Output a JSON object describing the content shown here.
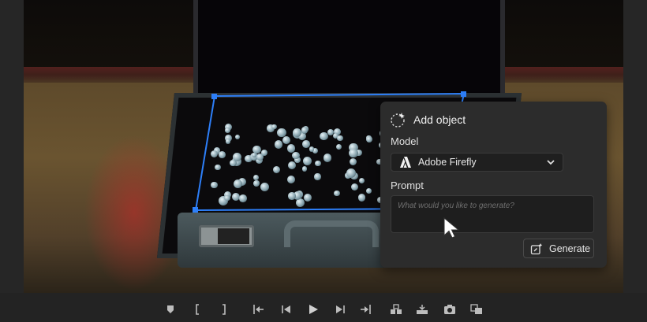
{
  "panel": {
    "title": "Add object",
    "model_label": "Model",
    "model_value": "Adobe Firefly",
    "prompt_label": "Prompt",
    "prompt_placeholder": "What would you like to generate?",
    "generate_label": "Generate"
  },
  "colors": {
    "selection_blue": "#2d7ff9",
    "panel_bg": "#2c2c2c",
    "app_bg": "#232323"
  },
  "toolbar": {
    "icons": [
      "marker-icon",
      "mark-in-icon",
      "mark-out-icon",
      "go-to-in-icon",
      "step-back-icon",
      "play-icon",
      "step-forward-icon",
      "go-to-out-icon",
      "insert-icon",
      "overwrite-icon",
      "export-frame-icon",
      "compare-icon"
    ]
  }
}
